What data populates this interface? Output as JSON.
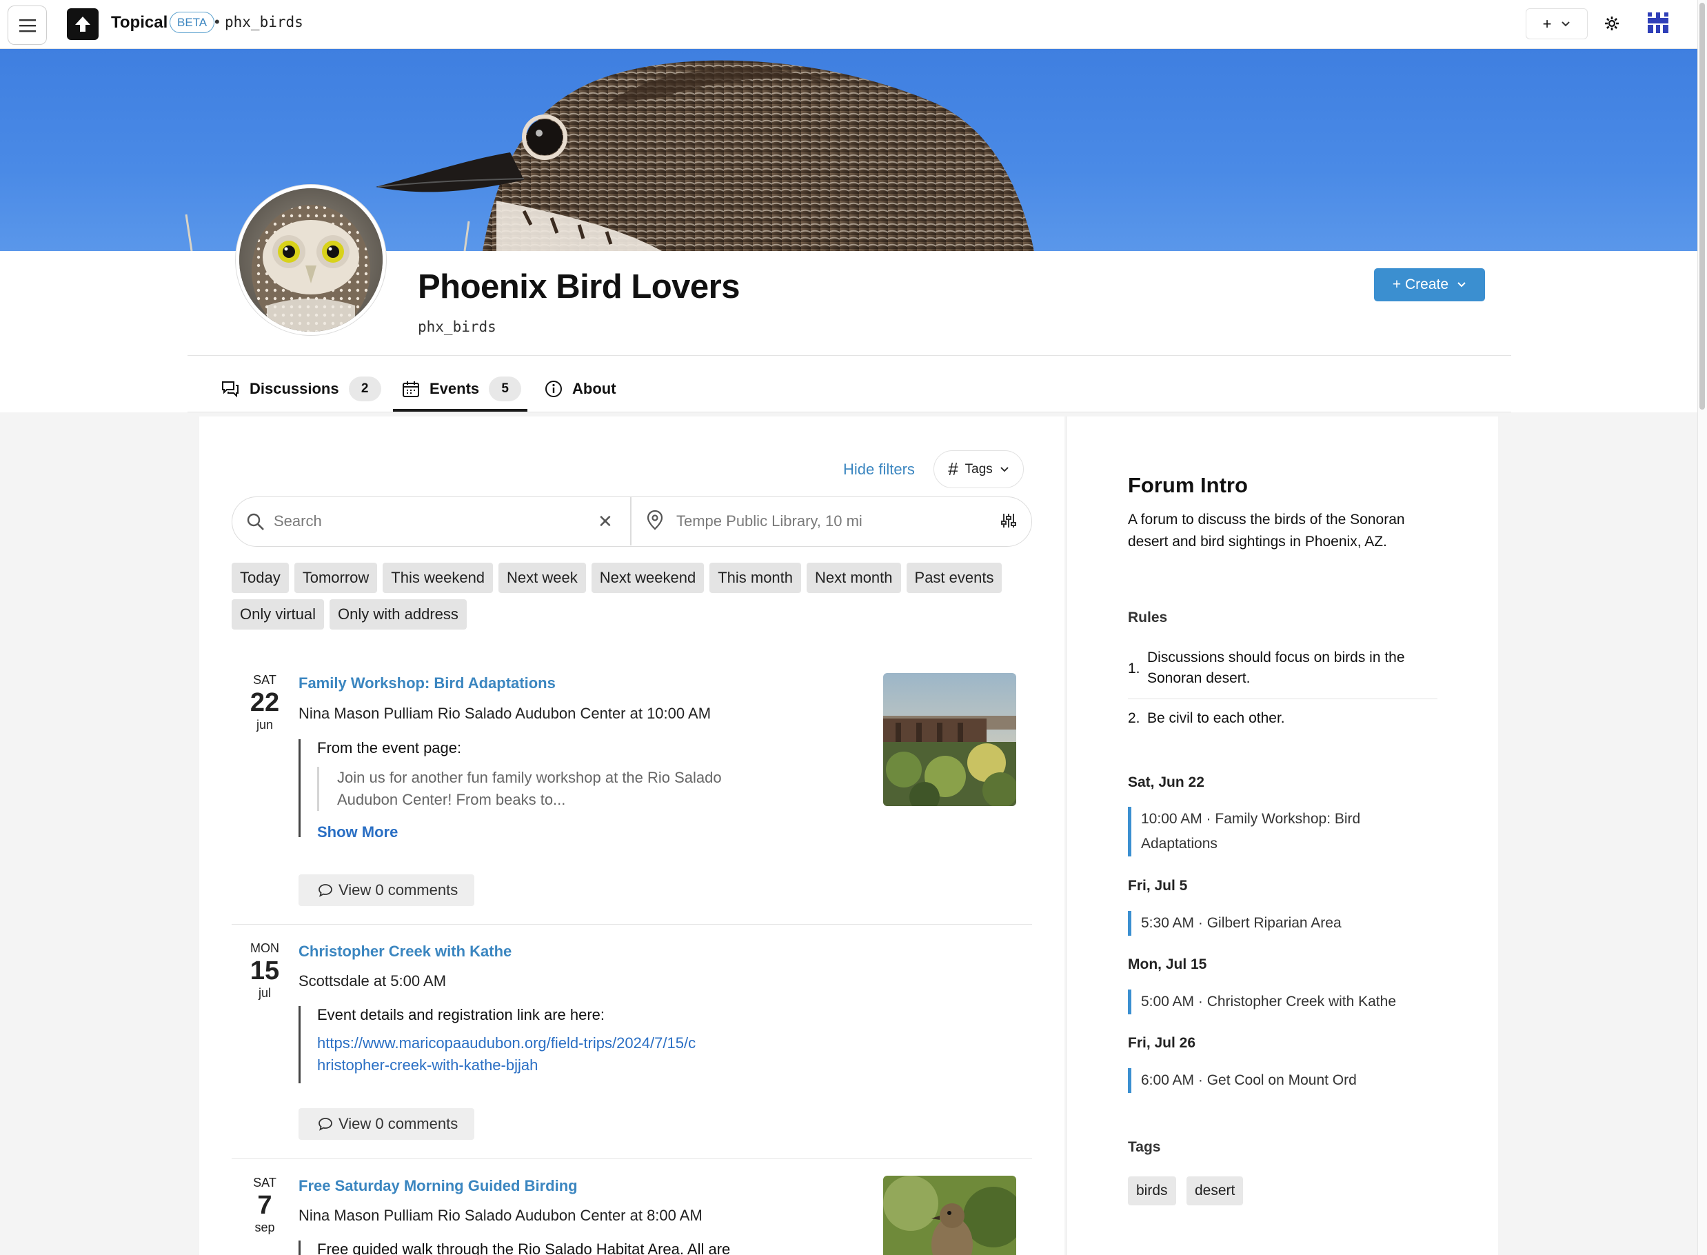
{
  "nav": {
    "brand": "Topical",
    "beta": "BETA",
    "separator": "•",
    "forum_slug": "phx_birds",
    "create_plus": "+"
  },
  "header": {
    "title": "Phoenix Bird Lovers",
    "handle": "phx_birds",
    "create_label": "+ Create"
  },
  "tabs": [
    {
      "label": "Discussions",
      "count": "2",
      "icon": "discussion-icon"
    },
    {
      "label": "Events",
      "count": "5",
      "icon": "calendar-icon",
      "active": true
    },
    {
      "label": "About",
      "icon": "info-icon"
    }
  ],
  "filters": {
    "hide_filters": "Hide filters",
    "tags_label": "Tags",
    "search_placeholder": "Search",
    "location_placeholder": "Tempe Public Library, 10 mi",
    "chips": [
      "Today",
      "Tomorrow",
      "This weekend",
      "Next week",
      "Next weekend",
      "This month",
      "Next month",
      "Past events",
      "Only virtual",
      "Only with address"
    ]
  },
  "events": [
    {
      "dow": "SAT",
      "day": "22",
      "month": "jun",
      "title": "Family Workshop: Bird Adaptations",
      "where": "Nina Mason Pulliam Rio Salado Audubon Center at 10:00 AM",
      "lead": "From the event page:",
      "excerpt": "Join us for another fun family workshop at the Rio Salado Audubon Center! From beaks to...",
      "show_more": "Show More",
      "comments": "View 0 comments"
    },
    {
      "dow": "MON",
      "day": "15",
      "month": "jul",
      "title": "Christopher Creek with Kathe",
      "where": "Scottsdale at 5:00 AM",
      "lead": "Event details and registration link are here:",
      "link": "https://www.maricopaaudubon.org/field-trips/2024/7/15/christopher-creek-with-kathe-bjjah",
      "comments": "View 0 comments"
    },
    {
      "dow": "SAT",
      "day": "7",
      "month": "sep",
      "title": "Free Saturday Morning Guided Birding",
      "where": "Nina Mason Pulliam Rio Salado Audubon Center at 8:00 AM",
      "lead": "Free guided walk through the Rio Salado Habitat Area. All are"
    }
  ],
  "sidebar": {
    "intro_title": "Forum Intro",
    "intro_text": "A forum to discuss the birds of the Sonoran desert and bird sightings in Phoenix, AZ.",
    "rules_heading": "Rules",
    "rules": [
      {
        "num": "1.",
        "text": "Discussions should focus on birds in the Sonoran desert."
      },
      {
        "num": "2.",
        "text": "Be civil to each other."
      }
    ],
    "schedule": [
      {
        "date": "Sat, Jun 22",
        "item": "10:00 AM · Family Workshop: Bird Adaptations"
      },
      {
        "date": "Fri, Jul 5",
        "item": "5:30 AM · Gilbert Riparian Area"
      },
      {
        "date": "Mon, Jul 15",
        "item": "5:00 AM · Christopher Creek with Kathe"
      },
      {
        "date": "Fri, Jul 26",
        "item": "6:00 AM · Get Cool on Mount Ord"
      }
    ],
    "tags_heading": "Tags",
    "tags": [
      "birds",
      "desert"
    ]
  },
  "colors": {
    "accent": "#3b8fd0",
    "link": "#3b86c0",
    "banner_sky": "#4a8ae6"
  }
}
